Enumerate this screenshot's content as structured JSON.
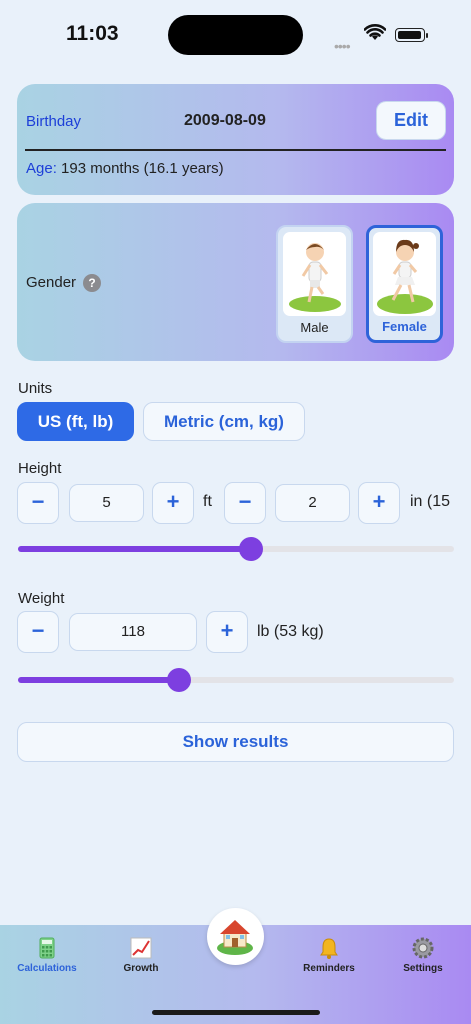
{
  "status_bar": {
    "time": "11:03"
  },
  "birthday": {
    "label": "Birthday",
    "value": "2009-08-09",
    "edit_label": "Edit",
    "age_label": "Age:",
    "age_value": "193 months (16.1 years)"
  },
  "gender": {
    "label": "Gender",
    "help_glyph": "?",
    "options": [
      {
        "label": "Male",
        "selected": false
      },
      {
        "label": "Female",
        "selected": true
      }
    ]
  },
  "units": {
    "label": "Units",
    "options": [
      {
        "label": "US (ft, lb)",
        "selected": true
      },
      {
        "label": "Metric (cm, kg)",
        "selected": false
      }
    ]
  },
  "height": {
    "label": "Height",
    "minus": "−",
    "plus": "+",
    "feet_value": "5",
    "feet_unit": "ft",
    "inches_value": "2",
    "inches_unit": "in  (15",
    "slider_fraction": 0.535
  },
  "weight": {
    "label": "Weight",
    "minus": "−",
    "plus": "+",
    "value": "118",
    "unit": "lb  (53 kg)",
    "slider_fraction": 0.37
  },
  "show_results_label": "Show results",
  "tab_bar": {
    "tabs": [
      {
        "label": "Calculations",
        "icon": "calculator-icon",
        "active": true
      },
      {
        "label": "Growth",
        "icon": "chart-icon",
        "active": false
      },
      {
        "label": "Reminders",
        "icon": "bell-icon",
        "active": false
      },
      {
        "label": "Settings",
        "icon": "gear-icon",
        "active": false
      }
    ],
    "center_icon": "house-icon"
  },
  "colors": {
    "accent": "#2e6ae6",
    "slider": "#7d3fe0",
    "background": "#e9f1fa"
  }
}
